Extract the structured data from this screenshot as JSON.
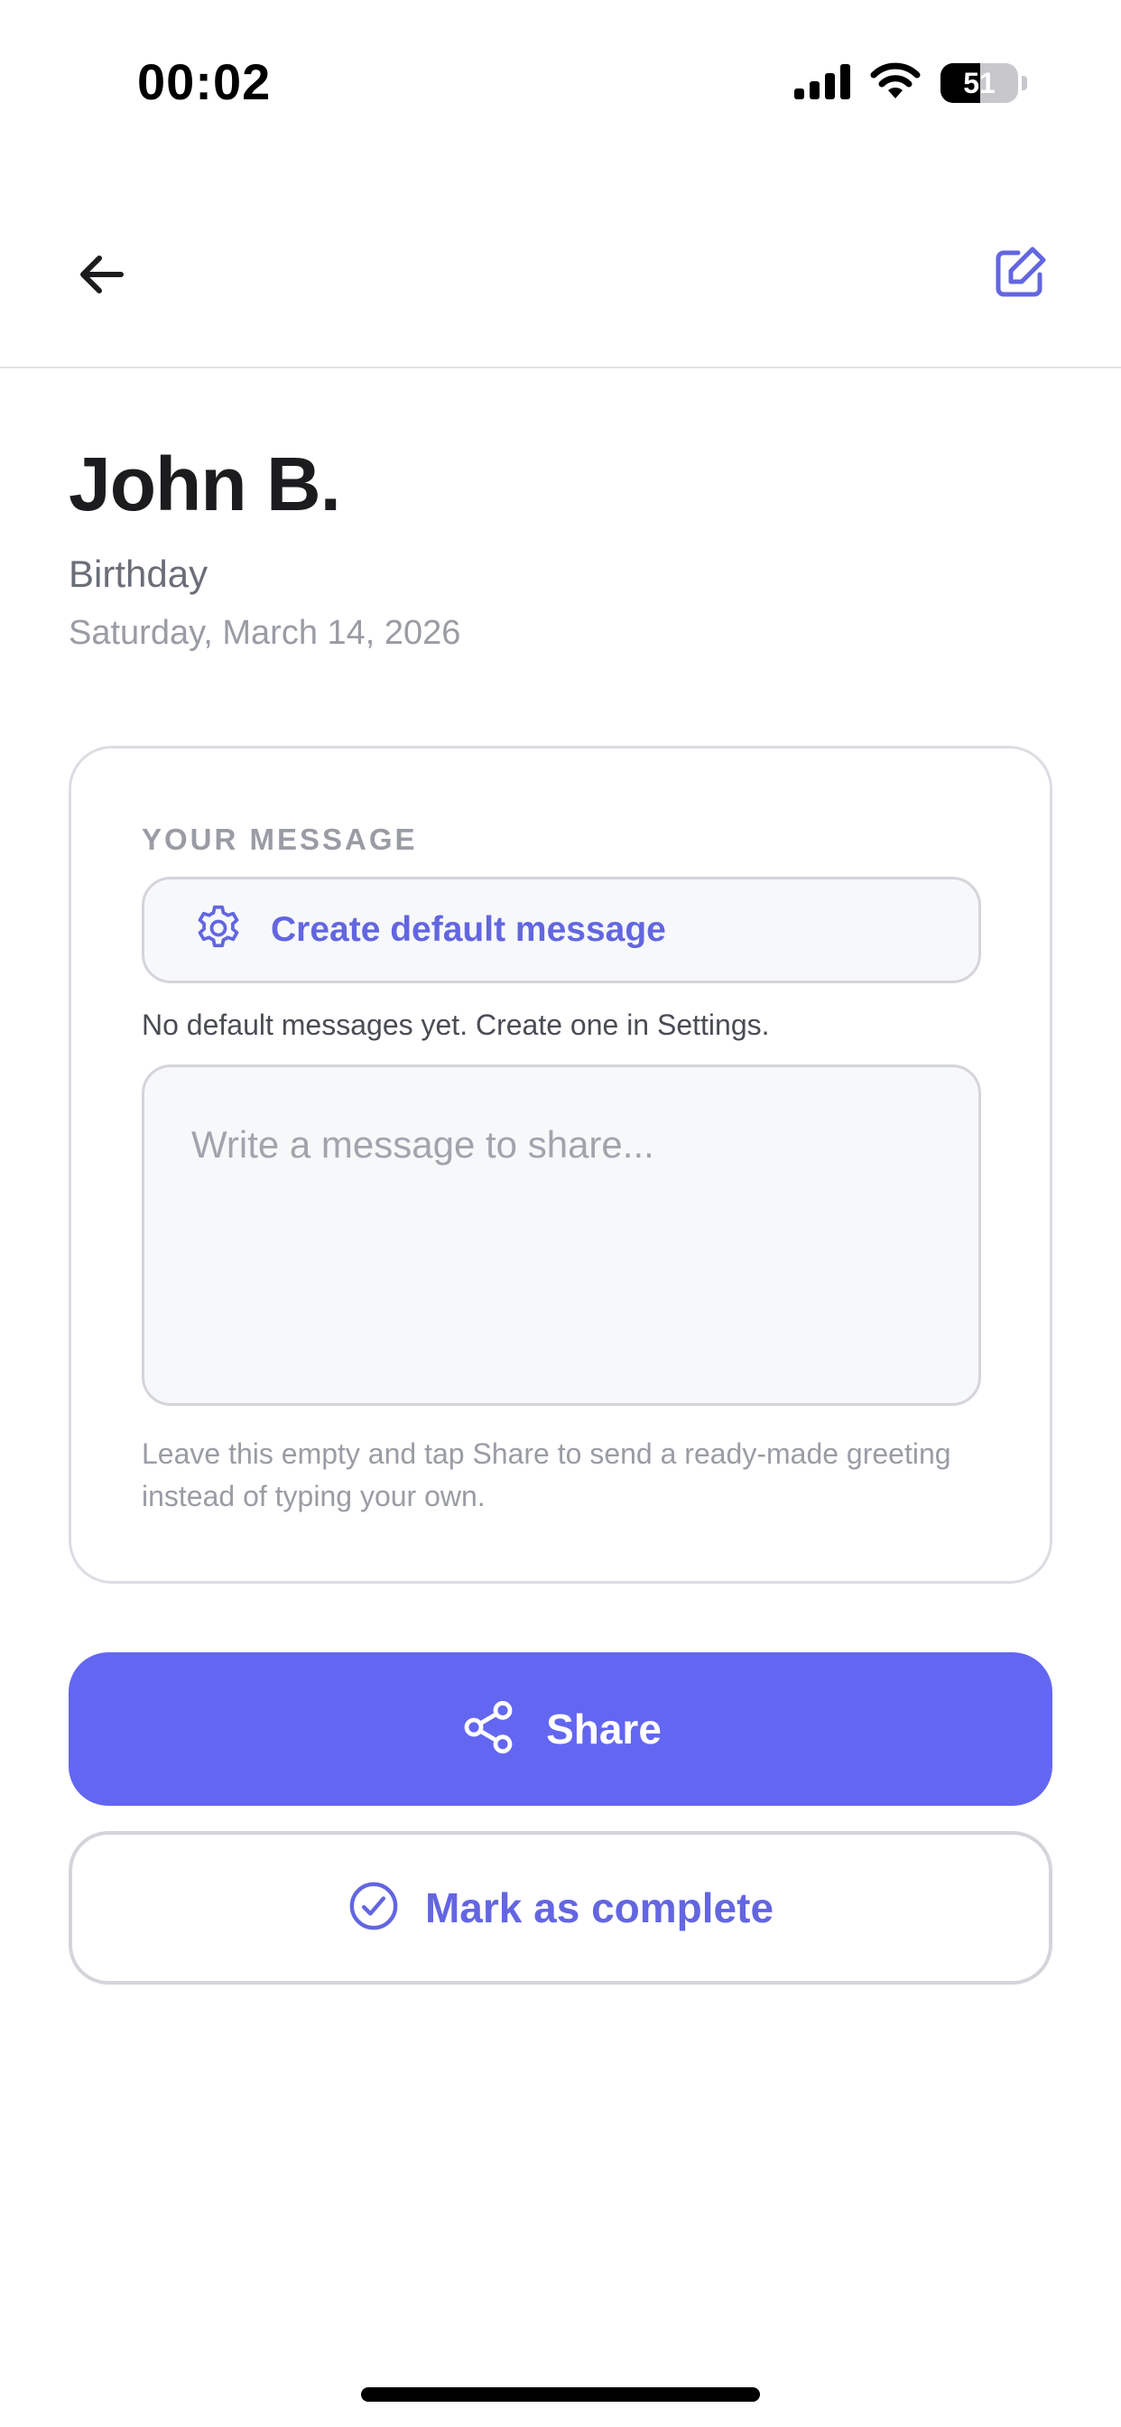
{
  "status_bar": {
    "time": "00:02",
    "battery_level": "51",
    "icons": [
      "cellular-signal-icon",
      "wifi-icon",
      "battery-icon"
    ]
  },
  "nav": {
    "back_icon": "arrow-left-icon",
    "edit_icon": "edit-square-icon"
  },
  "contact": {
    "name": "John B.",
    "event_type": "Birthday",
    "event_date": "Saturday, March 14, 2026"
  },
  "message_card": {
    "section_label": "YOUR MESSAGE",
    "default_button_label": "Create default message",
    "default_button_icon": "gear-icon",
    "no_default_note": "No default messages yet. Create one in Settings.",
    "input_value": "",
    "input_placeholder": "Write a message to share...",
    "hint": "Leave this empty and tap Share to send a ready-made greeting instead of typing your own."
  },
  "actions": {
    "share_label": "Share",
    "share_icon": "share-icon",
    "complete_label": "Mark as complete",
    "complete_icon": "check-circle-icon"
  },
  "colors": {
    "accent": "#6366f1",
    "accent_text": "#6366e0",
    "text_primary": "#1c1c1e",
    "text_secondary": "#6b6e78",
    "text_muted": "#9a9ca5",
    "border": "#d4d4da",
    "field_background": "#f7f8fa"
  }
}
